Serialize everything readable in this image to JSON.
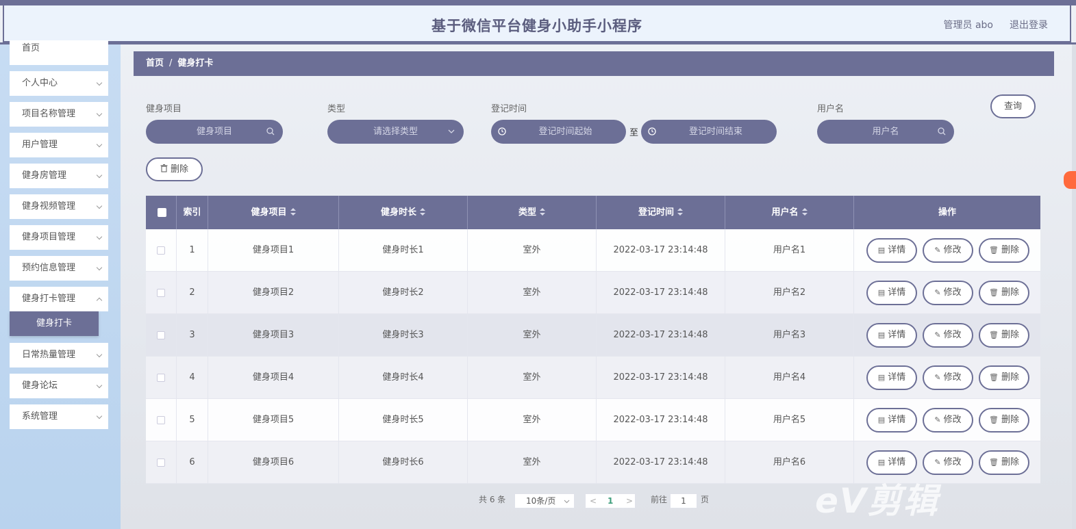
{
  "header": {
    "title": "基于微信平台健身小助手小程序",
    "admin": "管理员 abo",
    "logout": "退出登录"
  },
  "sidebar": {
    "items": [
      {
        "label": "首页"
      },
      {
        "label": "个人中心"
      },
      {
        "label": "项目名称管理"
      },
      {
        "label": "用户管理"
      },
      {
        "label": "健身房管理"
      },
      {
        "label": "健身视频管理"
      },
      {
        "label": "健身项目管理"
      },
      {
        "label": "预约信息管理"
      },
      {
        "label": "健身打卡管理"
      },
      {
        "label": "健身打卡"
      },
      {
        "label": "日常热量管理"
      },
      {
        "label": "健身论坛"
      },
      {
        "label": "系统管理"
      }
    ]
  },
  "breadcrumb": {
    "home": "首页",
    "separator": "/",
    "current": "健身打卡"
  },
  "filters": {
    "project": {
      "label": "健身项目",
      "placeholder": "健身项目"
    },
    "type": {
      "label": "类型",
      "placeholder": "请选择类型"
    },
    "time": {
      "label": "登记时间",
      "start_placeholder": "登记时间起始",
      "to": "至",
      "end_placeholder": "登记时间结束"
    },
    "username": {
      "label": "用户名",
      "placeholder": "用户名"
    },
    "query_label": "查询",
    "delete_label": "删除"
  },
  "table": {
    "columns": [
      "索引",
      "健身项目",
      "健身时长",
      "类型",
      "登记时间",
      "用户名",
      "操作"
    ],
    "rows": [
      {
        "index": "1",
        "project": "健身项目1",
        "duration": "健身时长1",
        "type": "室外",
        "time": "2022-03-17 23:14:48",
        "user": "用户名1"
      },
      {
        "index": "2",
        "project": "健身项目2",
        "duration": "健身时长2",
        "type": "室外",
        "time": "2022-03-17 23:14:48",
        "user": "用户名2"
      },
      {
        "index": "3",
        "project": "健身项目3",
        "duration": "健身时长3",
        "type": "室外",
        "time": "2022-03-17 23:14:48",
        "user": "用户名3"
      },
      {
        "index": "4",
        "project": "健身项目4",
        "duration": "健身时长4",
        "type": "室外",
        "time": "2022-03-17 23:14:48",
        "user": "用户名4"
      },
      {
        "index": "5",
        "project": "健身项目5",
        "duration": "健身时长5",
        "type": "室外",
        "time": "2022-03-17 23:14:48",
        "user": "用户名5"
      },
      {
        "index": "6",
        "project": "健身项目6",
        "duration": "健身时长6",
        "type": "室外",
        "time": "2022-03-17 23:14:48",
        "user": "用户名6"
      }
    ],
    "actions": {
      "detail": "详情",
      "edit": "修改",
      "delete": "删除"
    }
  },
  "pagination": {
    "total": "共 6 条",
    "page_size": "10条/页",
    "prev": "<",
    "current_page": "1",
    "next": ">",
    "goto_label": "前往",
    "goto_value": "1",
    "page_suffix": "页"
  },
  "watermark": "eV剪辑",
  "colors": {
    "accent": "#6c6f96",
    "header_bg": "#ecf3fc",
    "sidebar_bg": "#c7dcf3"
  }
}
